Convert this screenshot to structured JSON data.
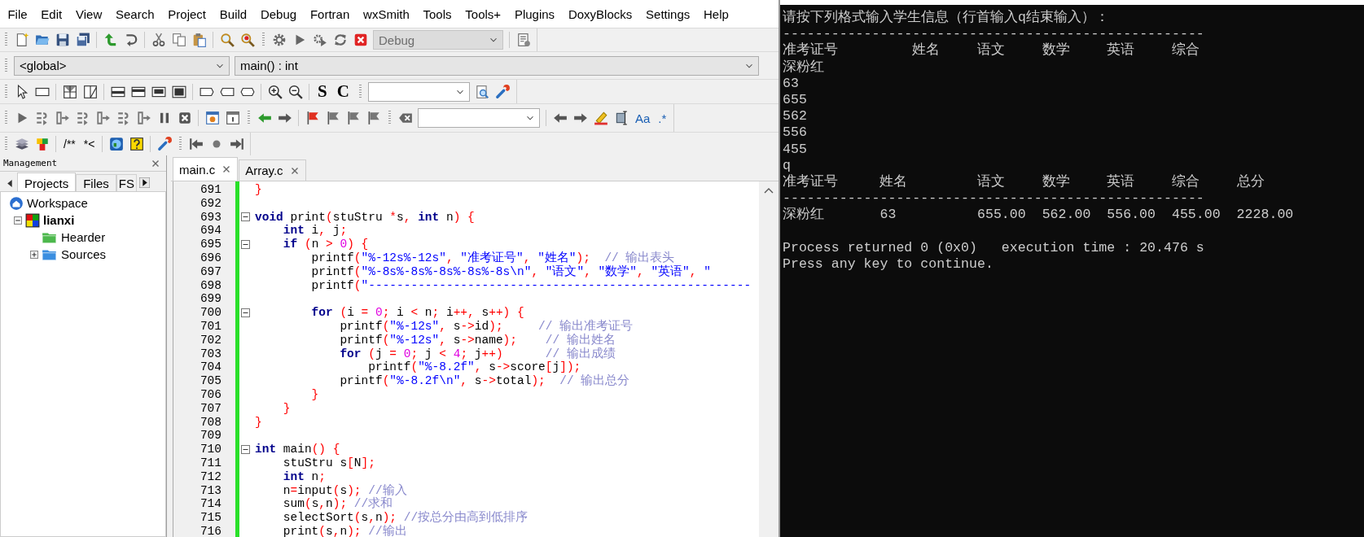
{
  "menu_bar": [
    "File",
    "Edit",
    "View",
    "Search",
    "Project",
    "Build",
    "Debug",
    "Fortran",
    "wxSmith",
    "Tools",
    "Tools+",
    "Plugins",
    "DoxyBlocks",
    "Settings",
    "Help"
  ],
  "main_toolbar": {
    "build_target": {
      "value": "Debug",
      "disabled": true
    }
  },
  "code_completion_bar": {
    "scope": "<global>",
    "symbol": "main() : int"
  },
  "wxsmith_toolbar": {
    "labels": [
      "S",
      "C"
    ]
  },
  "search_toolbar": {
    "labels": [
      "Aa",
      ".*"
    ]
  },
  "doxyblocks_toolbar": {
    "labels": [
      "/**",
      "*<"
    ]
  },
  "management": {
    "title": "Management",
    "tabs": [
      {
        "label": "Projects",
        "selected": true
      },
      {
        "label": "Files",
        "selected": false
      },
      {
        "label": "FS",
        "selected": false
      }
    ],
    "tree": [
      {
        "label": "Workspace",
        "kind": "workspace",
        "children": [
          {
            "label": "lianxi",
            "kind": "project",
            "active": true,
            "expanded": true,
            "children": [
              {
                "label": "Hearder",
                "kind": "folder",
                "color": "#4cb84c"
              },
              {
                "label": "Sources",
                "kind": "folder",
                "color": "#3a8ee0",
                "expanded": false
              }
            ]
          }
        ]
      }
    ]
  },
  "editor": {
    "tabs": [
      {
        "label": "main.c",
        "selected": true
      },
      {
        "label": "Array.c",
        "selected": false
      }
    ],
    "lines": [
      {
        "number": "691",
        "fold": false,
        "tokens": [
          {
            "kind": "operator",
            "text": "}"
          }
        ]
      },
      {
        "number": "692",
        "fold": false
      },
      {
        "number": "693",
        "fold": true,
        "tokens": [
          {
            "kind": "keyword",
            "text": "void"
          },
          {
            "kind": "plain",
            "text": " print"
          },
          {
            "kind": "operator",
            "text": "("
          },
          {
            "kind": "plain",
            "text": "stuStru "
          },
          {
            "kind": "operator",
            "text": "*"
          },
          {
            "kind": "plain",
            "text": "s"
          },
          {
            "kind": "operator",
            "text": ","
          },
          {
            "kind": "keyword",
            "text": " int"
          },
          {
            "kind": "plain",
            "text": " n"
          },
          {
            "kind": "operator",
            "text": ")"
          },
          {
            "kind": "operator",
            "text": " {"
          }
        ]
      },
      {
        "number": "694",
        "fold": false,
        "tokens": [
          {
            "kind": "keyword",
            "text": "    int"
          },
          {
            "kind": "plain",
            "text": " i"
          },
          {
            "kind": "operator",
            "text": ","
          },
          {
            "kind": "plain",
            "text": " j"
          },
          {
            "kind": "operator",
            "text": ";"
          }
        ]
      },
      {
        "number": "695",
        "fold": true,
        "tokens": [
          {
            "kind": "keyword",
            "text": "    if"
          },
          {
            "kind": "operator",
            "text": " ("
          },
          {
            "kind": "plain",
            "text": "n "
          },
          {
            "kind": "operator",
            "text": ">"
          },
          {
            "kind": "number",
            "text": " 0"
          },
          {
            "kind": "operator",
            "text": ")"
          },
          {
            "kind": "operator",
            "text": " {"
          }
        ]
      },
      {
        "number": "696",
        "fold": false,
        "tokens": [
          {
            "kind": "plain",
            "text": "        printf"
          },
          {
            "kind": "operator",
            "text": "("
          },
          {
            "kind": "string",
            "text": "\"%-12s%-12s\""
          },
          {
            "kind": "operator",
            "text": ","
          },
          {
            "kind": "string",
            "text": " \"准考证号\""
          },
          {
            "kind": "operator",
            "text": ","
          },
          {
            "kind": "string",
            "text": " \"姓名\""
          },
          {
            "kind": "operator",
            "text": ");"
          },
          {
            "kind": "comment",
            "text": "  // 输出表头"
          }
        ]
      },
      {
        "number": "697",
        "fold": false,
        "tokens": [
          {
            "kind": "plain",
            "text": "        printf"
          },
          {
            "kind": "operator",
            "text": "("
          },
          {
            "kind": "string",
            "text": "\"%-8s%-8s%-8s%-8s%-8s\\n\""
          },
          {
            "kind": "operator",
            "text": ","
          },
          {
            "kind": "string",
            "text": " \"语文\""
          },
          {
            "kind": "operator",
            "text": ","
          },
          {
            "kind": "string",
            "text": " \"数学\""
          },
          {
            "kind": "operator",
            "text": ","
          },
          {
            "kind": "string",
            "text": " \"英语\""
          },
          {
            "kind": "operator",
            "text": ","
          },
          {
            "kind": "string",
            "text": " \""
          }
        ]
      },
      {
        "number": "698",
        "fold": false,
        "tokens": [
          {
            "kind": "plain",
            "text": "        printf"
          },
          {
            "kind": "operator",
            "text": "("
          },
          {
            "kind": "string",
            "text": "\"------------------------------------------------------"
          }
        ]
      },
      {
        "number": "699",
        "fold": false
      },
      {
        "number": "700",
        "fold": true,
        "tokens": [
          {
            "kind": "keyword",
            "text": "        for"
          },
          {
            "kind": "operator",
            "text": " ("
          },
          {
            "kind": "plain",
            "text": "i "
          },
          {
            "kind": "operator",
            "text": "="
          },
          {
            "kind": "number",
            "text": " 0"
          },
          {
            "kind": "operator",
            "text": ";"
          },
          {
            "kind": "plain",
            "text": " i "
          },
          {
            "kind": "operator",
            "text": "<"
          },
          {
            "kind": "plain",
            "text": " n"
          },
          {
            "kind": "operator",
            "text": ";"
          },
          {
            "kind": "plain",
            "text": " i"
          },
          {
            "kind": "operator",
            "text": "++,"
          },
          {
            "kind": "plain",
            "text": " s"
          },
          {
            "kind": "operator",
            "text": "++)"
          },
          {
            "kind": "operator",
            "text": " {"
          }
        ]
      },
      {
        "number": "701",
        "fold": false,
        "tokens": [
          {
            "kind": "plain",
            "text": "            printf"
          },
          {
            "kind": "operator",
            "text": "("
          },
          {
            "kind": "string",
            "text": "\"%-12s\""
          },
          {
            "kind": "operator",
            "text": ","
          },
          {
            "kind": "plain",
            "text": " s"
          },
          {
            "kind": "operator",
            "text": "->"
          },
          {
            "kind": "plain",
            "text": "id"
          },
          {
            "kind": "operator",
            "text": ");"
          },
          {
            "kind": "comment",
            "text": "     // 输出准考证号"
          }
        ]
      },
      {
        "number": "702",
        "fold": false,
        "tokens": [
          {
            "kind": "plain",
            "text": "            printf"
          },
          {
            "kind": "operator",
            "text": "("
          },
          {
            "kind": "string",
            "text": "\"%-12s\""
          },
          {
            "kind": "operator",
            "text": ","
          },
          {
            "kind": "plain",
            "text": " s"
          },
          {
            "kind": "operator",
            "text": "->"
          },
          {
            "kind": "plain",
            "text": "name"
          },
          {
            "kind": "operator",
            "text": ");"
          },
          {
            "kind": "comment",
            "text": "    // 输出姓名"
          }
        ]
      },
      {
        "number": "703",
        "fold": false,
        "tokens": [
          {
            "kind": "keyword",
            "text": "            for"
          },
          {
            "kind": "operator",
            "text": " ("
          },
          {
            "kind": "plain",
            "text": "j "
          },
          {
            "kind": "operator",
            "text": "="
          },
          {
            "kind": "number",
            "text": " 0"
          },
          {
            "kind": "operator",
            "text": ";"
          },
          {
            "kind": "plain",
            "text": " j "
          },
          {
            "kind": "operator",
            "text": "<"
          },
          {
            "kind": "number",
            "text": " 4"
          },
          {
            "kind": "operator",
            "text": ";"
          },
          {
            "kind": "plain",
            "text": " j"
          },
          {
            "kind": "operator",
            "text": "++)"
          },
          {
            "kind": "comment",
            "text": "      // 输出成绩"
          }
        ]
      },
      {
        "number": "704",
        "fold": false,
        "tokens": [
          {
            "kind": "plain",
            "text": "                printf"
          },
          {
            "kind": "operator",
            "text": "("
          },
          {
            "kind": "string",
            "text": "\"%-8.2f\""
          },
          {
            "kind": "operator",
            "text": ","
          },
          {
            "kind": "plain",
            "text": " s"
          },
          {
            "kind": "operator",
            "text": "->"
          },
          {
            "kind": "plain",
            "text": "score"
          },
          {
            "kind": "operator",
            "text": "["
          },
          {
            "kind": "plain",
            "text": "j"
          },
          {
            "kind": "operator",
            "text": "]);"
          }
        ]
      },
      {
        "number": "705",
        "fold": false,
        "tokens": [
          {
            "kind": "plain",
            "text": "            printf"
          },
          {
            "kind": "operator",
            "text": "("
          },
          {
            "kind": "string",
            "text": "\"%-8.2f\\n\""
          },
          {
            "kind": "operator",
            "text": ","
          },
          {
            "kind": "plain",
            "text": " s"
          },
          {
            "kind": "operator",
            "text": "->"
          },
          {
            "kind": "plain",
            "text": "total"
          },
          {
            "kind": "operator",
            "text": ");"
          },
          {
            "kind": "comment",
            "text": "  // 输出总分"
          }
        ]
      },
      {
        "number": "706",
        "fold": false,
        "tokens": [
          {
            "kind": "operator",
            "text": "        }"
          }
        ]
      },
      {
        "number": "707",
        "fold": false,
        "tokens": [
          {
            "kind": "operator",
            "text": "    }"
          }
        ]
      },
      {
        "number": "708",
        "fold": false,
        "tokens": [
          {
            "kind": "operator",
            "text": "}"
          }
        ]
      },
      {
        "number": "709",
        "fold": false
      },
      {
        "number": "710",
        "fold": true,
        "tokens": [
          {
            "kind": "keyword",
            "text": "int"
          },
          {
            "kind": "plain",
            "text": " main"
          },
          {
            "kind": "operator",
            "text": "()"
          },
          {
            "kind": "operator",
            "text": " {"
          }
        ]
      },
      {
        "number": "711",
        "fold": false,
        "tokens": [
          {
            "kind": "plain",
            "text": "    stuStru s"
          },
          {
            "kind": "operator",
            "text": "["
          },
          {
            "kind": "plain",
            "text": "N"
          },
          {
            "kind": "operator",
            "text": "];"
          }
        ]
      },
      {
        "number": "712",
        "fold": false,
        "tokens": [
          {
            "kind": "keyword",
            "text": "    int"
          },
          {
            "kind": "plain",
            "text": " n"
          },
          {
            "kind": "operator",
            "text": ";"
          }
        ]
      },
      {
        "number": "713",
        "fold": false,
        "tokens": [
          {
            "kind": "plain",
            "text": "    n"
          },
          {
            "kind": "operator",
            "text": "="
          },
          {
            "kind": "plain",
            "text": "input"
          },
          {
            "kind": "operator",
            "text": "("
          },
          {
            "kind": "plain",
            "text": "s"
          },
          {
            "kind": "operator",
            "text": ");"
          },
          {
            "kind": "comment",
            "text": " //输入"
          }
        ]
      },
      {
        "number": "714",
        "fold": false,
        "tokens": [
          {
            "kind": "plain",
            "text": "    sum"
          },
          {
            "kind": "operator",
            "text": "("
          },
          {
            "kind": "plain",
            "text": "s"
          },
          {
            "kind": "operator",
            "text": ","
          },
          {
            "kind": "plain",
            "text": "n"
          },
          {
            "kind": "operator",
            "text": ");"
          },
          {
            "kind": "comment",
            "text": " //求和"
          }
        ]
      },
      {
        "number": "715",
        "fold": false,
        "tokens": [
          {
            "kind": "plain",
            "text": "    selectSort"
          },
          {
            "kind": "operator",
            "text": "("
          },
          {
            "kind": "plain",
            "text": "s"
          },
          {
            "kind": "operator",
            "text": ","
          },
          {
            "kind": "plain",
            "text": "n"
          },
          {
            "kind": "operator",
            "text": ");"
          },
          {
            "kind": "comment",
            "text": " //按总分由高到低排序"
          }
        ]
      },
      {
        "number": "716",
        "fold": false,
        "tokens": [
          {
            "kind": "plain",
            "text": "    print"
          },
          {
            "kind": "operator",
            "text": "("
          },
          {
            "kind": "plain",
            "text": "s"
          },
          {
            "kind": "operator",
            "text": ","
          },
          {
            "kind": "plain",
            "text": "n"
          },
          {
            "kind": "operator",
            "text": ");"
          },
          {
            "kind": "comment",
            "text": " //输出"
          }
        ]
      }
    ]
  },
  "console": {
    "lines": [
      {
        "kind": "text",
        "text": "请按下列格式输入学生信息（行首输入q结束输入）："
      },
      {
        "kind": "text",
        "text": "----------------------------------------------------"
      },
      {
        "kind": "input_header",
        "cells": [
          "准考证号",
          "姓名",
          "语文",
          "数学",
          "英语",
          "综合"
        ]
      },
      {
        "kind": "text",
        "text": "深粉红"
      },
      {
        "kind": "text",
        "text": "63"
      },
      {
        "kind": "text",
        "text": "655"
      },
      {
        "kind": "text",
        "text": "562"
      },
      {
        "kind": "text",
        "text": "556"
      },
      {
        "kind": "text",
        "text": "455"
      },
      {
        "kind": "text",
        "text": "q"
      },
      {
        "kind": "table_row",
        "cells": [
          "准考证号",
          "姓名",
          "语文",
          "数学",
          "英语",
          "综合",
          "总分"
        ]
      },
      {
        "kind": "text",
        "text": "----------------------------------------------------"
      },
      {
        "kind": "table_row",
        "cells": [
          "深粉红",
          "63",
          "655.00",
          "562.00",
          "556.00",
          "455.00",
          "2228.00"
        ]
      },
      {
        "kind": "blank"
      },
      {
        "kind": "text",
        "text": "Process returned 0 (0x0)   execution time : 20.476 s"
      },
      {
        "kind": "text",
        "text": "Press any key to continue."
      }
    ]
  }
}
